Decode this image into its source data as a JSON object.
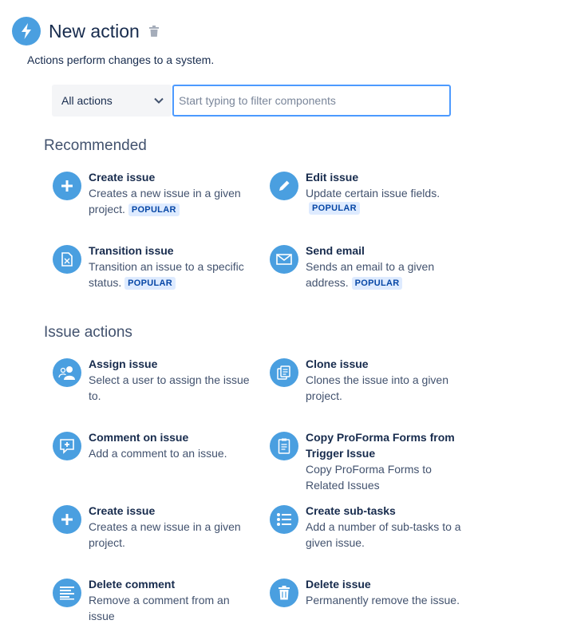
{
  "header": {
    "title": "New action",
    "subtitle": "Actions perform changes to a system."
  },
  "filter": {
    "select_value": "All actions",
    "search_placeholder": "Start typing to filter components"
  },
  "recommended": {
    "title": "Recommended",
    "items": [
      {
        "name": "Create issue",
        "desc": "Creates a new issue in a given project.",
        "badge": "POPULAR",
        "icon": "plus-icon"
      },
      {
        "name": "Edit issue",
        "desc": "Update certain issue fields.",
        "badge": "POPULAR",
        "icon": "pencil-icon"
      },
      {
        "name": "Transition issue",
        "desc": "Transition an issue to a specific status.",
        "badge": "POPULAR",
        "icon": "transition-icon"
      },
      {
        "name": "Send email",
        "desc": "Sends an email to a given address.",
        "badge": "POPULAR",
        "icon": "envelope-icon"
      }
    ]
  },
  "issue_actions": {
    "title": "Issue actions",
    "items": [
      {
        "name": "Assign issue",
        "desc": "Select a user to assign the issue to.",
        "icon": "assign-user-icon"
      },
      {
        "name": "Clone issue",
        "desc": "Clones the issue into a given project.",
        "icon": "clone-icon"
      },
      {
        "name": "Comment on issue",
        "desc": "Add a comment to an issue.",
        "icon": "comment-add-icon"
      },
      {
        "name": "Copy ProForma Forms from Trigger Issue",
        "desc": "Copy ProForma Forms to Related Issues",
        "icon": "form-icon"
      },
      {
        "name": "Create issue",
        "desc": "Creates a new issue in a given project.",
        "icon": "plus-icon"
      },
      {
        "name": "Create sub-tasks",
        "desc": "Add a number of sub-tasks to a given issue.",
        "icon": "list-icon"
      },
      {
        "name": "Delete comment",
        "desc": "Remove a comment from an issue",
        "icon": "text-lines-icon"
      },
      {
        "name": "Delete issue",
        "desc": "Permanently remove the issue.",
        "icon": "trash-icon"
      }
    ]
  },
  "colors": {
    "icon_bg": "#4a9fe0",
    "badge_bg": "#deebff",
    "badge_text": "#0747a6",
    "focus_border": "#4c9aff"
  }
}
